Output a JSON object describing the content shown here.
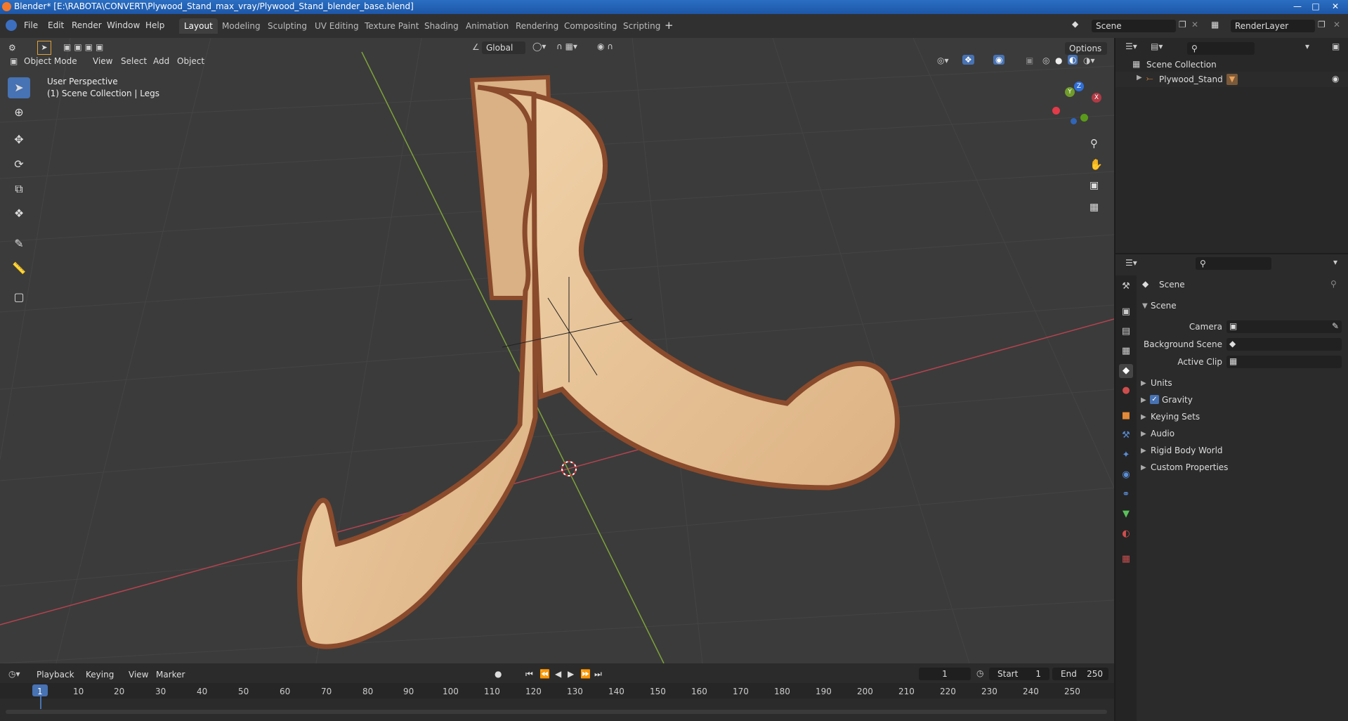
{
  "window": {
    "title": "Blender* [E:\\RABOTA\\CONVERT\\Plywood_Stand_max_vray/Plywood_Stand_blender_base.blend]"
  },
  "menu": [
    "File",
    "Edit",
    "Render",
    "Window",
    "Help"
  ],
  "workspaces": [
    {
      "label": "Layout",
      "active": true
    },
    {
      "label": "Modeling"
    },
    {
      "label": "Sculpting"
    },
    {
      "label": "UV Editing"
    },
    {
      "label": "Texture Paint"
    },
    {
      "label": "Shading"
    },
    {
      "label": "Animation"
    },
    {
      "label": "Rendering"
    },
    {
      "label": "Compositing"
    },
    {
      "label": "Scripting"
    }
  ],
  "scene_name": "Scene",
  "view_layer": "RenderLayer",
  "viewport": {
    "mode": "Object Mode",
    "menus": [
      "View",
      "Select",
      "Add",
      "Object"
    ],
    "transform_orientation": "Global",
    "options_label": "Options",
    "overlay_line1": "User Perspective",
    "overlay_line2": "(1) Scene Collection | Legs",
    "gizmo_axes": {
      "x": "X",
      "y": "Y",
      "z": "Z"
    }
  },
  "outliner": {
    "root": "Scene Collection",
    "items": [
      {
        "label": "Plywood_Stand"
      }
    ]
  },
  "properties": {
    "header": "Scene",
    "panel": "Scene",
    "fields": [
      {
        "label": "Camera"
      },
      {
        "label": "Background Scene"
      },
      {
        "label": "Active Clip"
      }
    ],
    "subpanels": [
      "Units",
      "Gravity",
      "Keying Sets",
      "Audio",
      "Rigid Body World",
      "Custom Properties"
    ],
    "gravity_checked": true
  },
  "timeline": {
    "menus": [
      "Playback",
      "Keying",
      "View",
      "Marker"
    ],
    "current_frame": "1",
    "start_label": "Start",
    "start": "1",
    "end_label": "End",
    "end": "250",
    "ticks": [
      "1",
      "10",
      "20",
      "30",
      "40",
      "50",
      "60",
      "70",
      "80",
      "90",
      "100",
      "110",
      "120",
      "130",
      "140",
      "150",
      "160",
      "170",
      "180",
      "190",
      "200",
      "210",
      "220",
      "230",
      "240",
      "250"
    ]
  },
  "colors": {
    "accent": "#4772b3",
    "wood_light": "#e8c497",
    "wood_edge": "#8a4a2c",
    "grid_bg": "#3b3b3b",
    "x_axis": "#b5434f",
    "y_axis": "#7ea33a"
  }
}
